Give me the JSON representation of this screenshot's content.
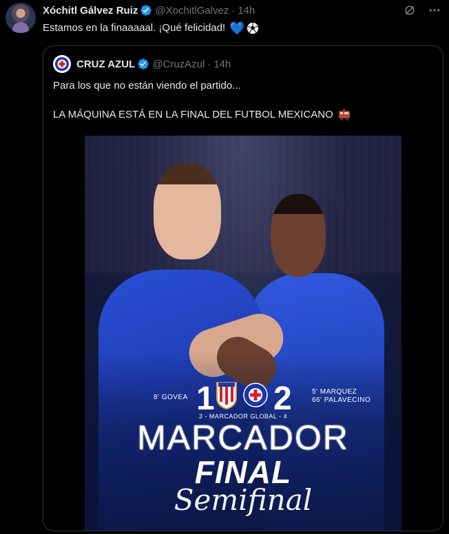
{
  "tweet": {
    "author_name": "Xóchitl Gálvez Ruiz",
    "handle": "@XochitlGalvez",
    "separator": "·",
    "time": "14h",
    "text": "Estamos en la finaaaaal. ¡Qué felicidad!",
    "emoji_heart": "💙",
    "icons": [
      "grok-icon",
      "more-icon"
    ]
  },
  "quote": {
    "author_name": "CRUZ AZUL",
    "handle": "@CruzAzul",
    "separator": "·",
    "time": "14h",
    "line1": "Para los que no están viendo el partido...",
    "line2": "LA MÁQUINA ESTÁ EN LA FINAL DEL FUTBOL MEXICANO"
  },
  "image": {
    "score_home": "1",
    "score_away": "2",
    "home_scorers": "8' GOVEA",
    "away_scorers_1": "5' MARQUEZ",
    "away_scorers_2": "66' PALAVECINO",
    "global": "3 - MARCADOR GLOBAL - 4",
    "title": "MARCADOR",
    "subtitle": "FINAL",
    "stage": "Semifinal"
  },
  "colors": {
    "background": "#000000",
    "text": "#e7e9ea",
    "muted": "#71767b",
    "verified": "#1d9bf0",
    "cruz_azul_blue": "#1a36a8"
  }
}
